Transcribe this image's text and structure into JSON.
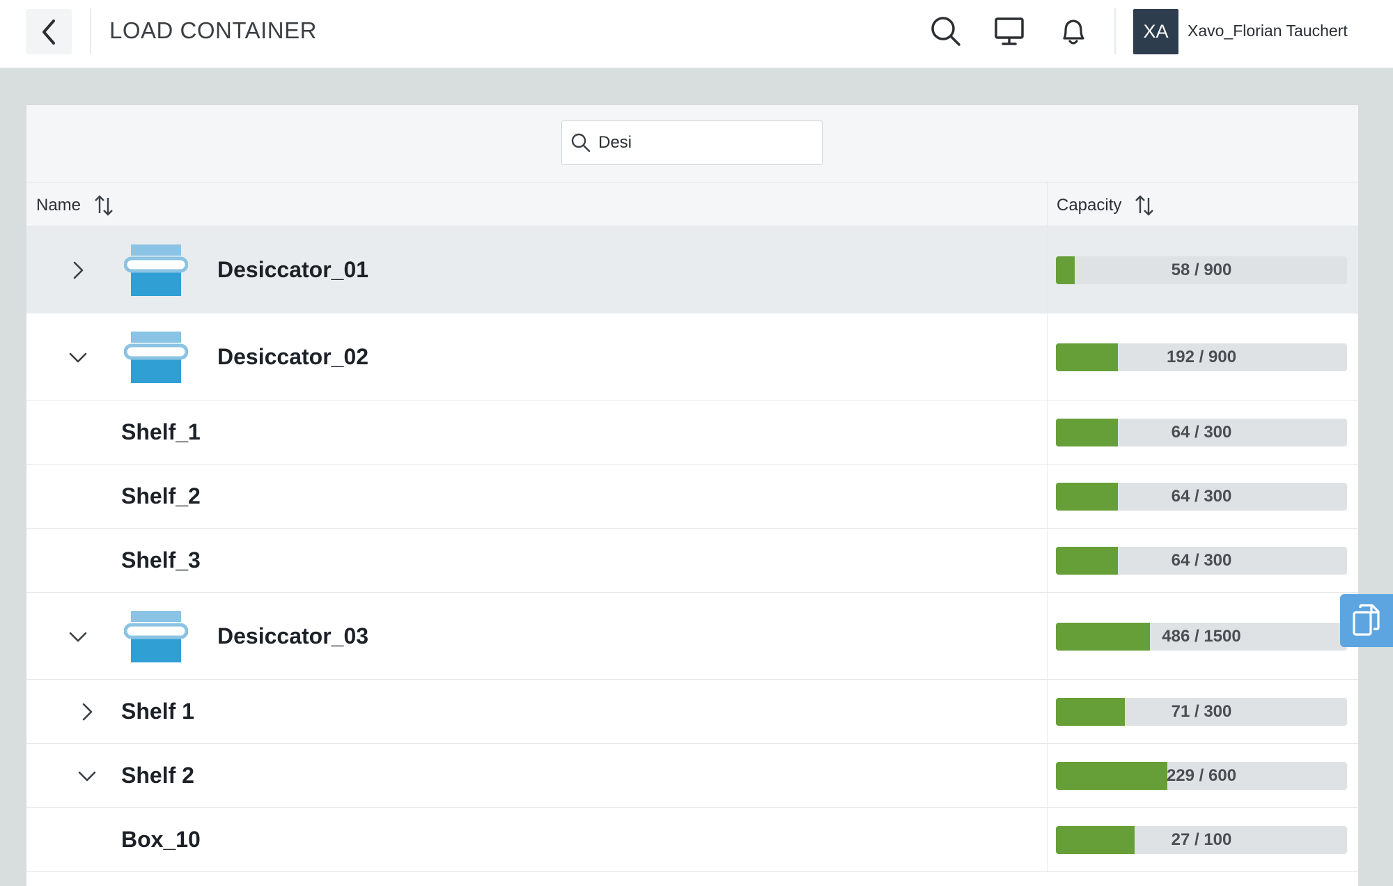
{
  "header": {
    "title": "LOAD CONTAINER",
    "user_initials": "XA",
    "user_name": "Xavo_Florian Tauchert"
  },
  "search": {
    "value": "Desi"
  },
  "table": {
    "col_name": "Name",
    "col_capacity": "Capacity"
  },
  "rows": [
    {
      "name": "Desiccator_01",
      "level": 0,
      "chevron": "right",
      "icon": "desiccator-icon",
      "used": 58,
      "total": 900,
      "capacity": "58 / 900",
      "selected": true
    },
    {
      "name": "Desiccator_02",
      "level": 0,
      "chevron": "down",
      "icon": "desiccator-icon",
      "used": 192,
      "total": 900,
      "capacity": "192 / 900"
    },
    {
      "name": "Shelf_1",
      "level": 1,
      "chevron": "",
      "used": 64,
      "total": 300,
      "capacity": "64 / 300"
    },
    {
      "name": "Shelf_2",
      "level": 1,
      "chevron": "",
      "used": 64,
      "total": 300,
      "capacity": "64 / 300"
    },
    {
      "name": "Shelf_3",
      "level": 1,
      "chevron": "",
      "used": 64,
      "total": 300,
      "capacity": "64 / 300"
    },
    {
      "name": "Desiccator_03",
      "level": 0,
      "chevron": "down",
      "icon": "desiccator-icon",
      "used": 486,
      "total": 1500,
      "capacity": "486 / 1500"
    },
    {
      "name": "Shelf 1",
      "level": 1,
      "chevron": "right",
      "used": 71,
      "total": 300,
      "capacity": "71 / 300"
    },
    {
      "name": "Shelf 2",
      "level": 1,
      "chevron": "down",
      "used": 229,
      "total": 600,
      "capacity": "229 / 600"
    },
    {
      "name": "Box_10",
      "level": 2,
      "chevron": "",
      "used": 27,
      "total": 100,
      "capacity": "27 / 100"
    }
  ],
  "colors": {
    "fill": "#669f38",
    "track": "#dfe2e5",
    "icon_light": "#8ac3e3",
    "icon_dark": "#2f9fd4",
    "side_tab": "#5da5e0"
  },
  "icons": [
    "back-arrow-icon",
    "search-icon",
    "monitor-icon",
    "bell-icon",
    "sort-icon",
    "chevron-right-icon",
    "chevron-down-icon",
    "desiccator-icon",
    "copy-icon"
  ]
}
